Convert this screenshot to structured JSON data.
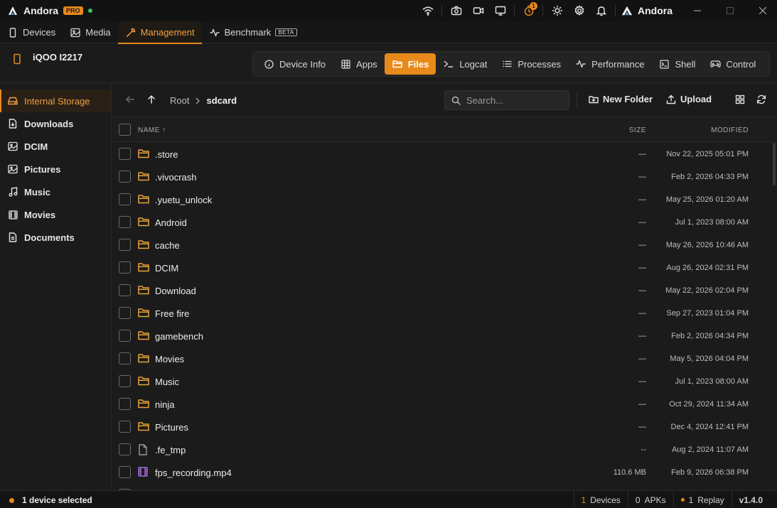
{
  "app": {
    "name": "Andora",
    "pro_label": "PRO",
    "brand": "Andora",
    "notification_count": "1"
  },
  "main_tabs": [
    {
      "label": "Devices",
      "icon": "phone-icon"
    },
    {
      "label": "Media",
      "icon": "image-icon"
    },
    {
      "label": "Management",
      "icon": "wrench-icon",
      "active": true
    },
    {
      "label": "Benchmark",
      "icon": "pulse-icon",
      "badge": "BETA"
    }
  ],
  "device": {
    "name": "iQOO I2217"
  },
  "sub_tabs": [
    {
      "label": "Device Info",
      "icon": "info-icon"
    },
    {
      "label": "Apps",
      "icon": "grid-icon"
    },
    {
      "label": "Files",
      "icon": "folder-icon",
      "active": true
    },
    {
      "label": "Logcat",
      "icon": "terminal-prompt-icon"
    },
    {
      "label": "Processes",
      "icon": "list-icon"
    },
    {
      "label": "Performance",
      "icon": "pulse-icon"
    },
    {
      "label": "Shell",
      "icon": "terminal-window-icon"
    },
    {
      "label": "Control",
      "icon": "gamepad-icon"
    }
  ],
  "sidebar": [
    {
      "label": "Internal Storage",
      "icon": "storage-icon",
      "active": true
    },
    {
      "label": "Downloads",
      "icon": "download-file-icon"
    },
    {
      "label": "DCIM",
      "icon": "camera-image-icon"
    },
    {
      "label": "Pictures",
      "icon": "image-icon"
    },
    {
      "label": "Music",
      "icon": "music-icon"
    },
    {
      "label": "Movies",
      "icon": "film-icon"
    },
    {
      "label": "Documents",
      "icon": "document-icon"
    }
  ],
  "breadcrumb": {
    "root": "Root",
    "current": "sdcard"
  },
  "search": {
    "placeholder": "Search...",
    "value": ""
  },
  "toolbar": {
    "new_folder": "New Folder",
    "upload": "Upload"
  },
  "table": {
    "col_name": "NAME ↑",
    "col_size": "SIZE",
    "col_modified": "MODIFIED",
    "rows": [
      {
        "name": ".store",
        "type": "folder",
        "size": "—",
        "modified": "Nov 22, 2025 05:01 PM"
      },
      {
        "name": ".vivocrash",
        "type": "folder",
        "size": "—",
        "modified": "Feb 2, 2026 04:33 PM"
      },
      {
        "name": ".yuetu_unlock",
        "type": "folder",
        "size": "—",
        "modified": "May 25, 2026 01:20 AM"
      },
      {
        "name": "Android",
        "type": "folder",
        "size": "—",
        "modified": "Jul 1, 2023 08:00 AM"
      },
      {
        "name": "cache",
        "type": "folder",
        "size": "—",
        "modified": "May 26, 2026 10:46 AM"
      },
      {
        "name": "DCIM",
        "type": "folder",
        "size": "—",
        "modified": "Aug 26, 2024 02:31 PM"
      },
      {
        "name": "Download",
        "type": "folder",
        "size": "—",
        "modified": "May 22, 2026 02:04 PM"
      },
      {
        "name": "Free fire",
        "type": "folder",
        "size": "—",
        "modified": "Sep 27, 2023 01:04 PM"
      },
      {
        "name": "gamebench",
        "type": "folder",
        "size": "—",
        "modified": "Feb 2, 2026 04:34 PM"
      },
      {
        "name": "Movies",
        "type": "folder",
        "size": "—",
        "modified": "May 5, 2026 04:04 PM"
      },
      {
        "name": "Music",
        "type": "folder",
        "size": "—",
        "modified": "Jul 1, 2023 08:00 AM"
      },
      {
        "name": "ninja",
        "type": "folder",
        "size": "—",
        "modified": "Oct 29, 2024 11:34 AM"
      },
      {
        "name": "Pictures",
        "type": "folder",
        "size": "—",
        "modified": "Dec 4, 2024 12:41 PM"
      },
      {
        "name": ".fe_tmp",
        "type": "file",
        "size": "--",
        "modified": "Aug 2, 2024 11:07 AM"
      },
      {
        "name": "fps_recording.mp4",
        "type": "video",
        "size": "110.6 MB",
        "modified": "Feb 9, 2026 06:38 PM"
      }
    ]
  },
  "status": {
    "selection": "1 device selected",
    "devices_count": "1",
    "devices_label": "Devices",
    "apks_count": "0",
    "apks_label": "APKs",
    "replay_count": "1",
    "replay_label": "Replay",
    "version": "v1.4.0"
  },
  "colors": {
    "accent": "#e8891c",
    "folder": "#e8a33a",
    "video": "#a66bd9",
    "online": "#35c25a"
  }
}
